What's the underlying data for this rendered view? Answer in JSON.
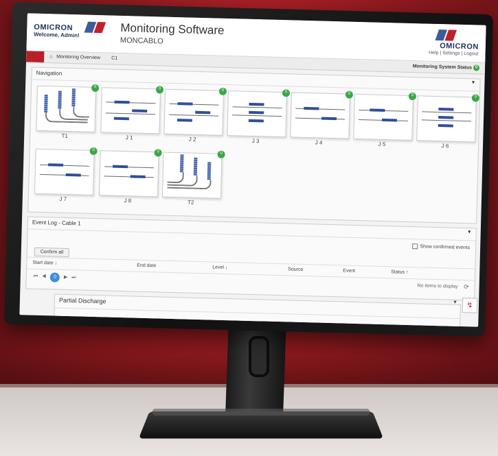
{
  "app": {
    "brand": "OMICRON",
    "welcome": "Welcome, Admin!",
    "title": "Monitoring Software",
    "subtitle": "MONCABLO",
    "right_links": "Help | Settings | Logout"
  },
  "breadcrumb": {
    "items": [
      "Monitoring Overview",
      "C1"
    ],
    "status_label": "Monitoring System Status",
    "status_value": "0"
  },
  "navigation": {
    "title": "Navigation",
    "tiles": [
      {
        "label": "T1",
        "badge": "0"
      },
      {
        "label": "J 1",
        "badge": "0"
      },
      {
        "label": "J 2",
        "badge": "0"
      },
      {
        "label": "J 3",
        "badge": "0"
      },
      {
        "label": "J 4",
        "badge": "0"
      },
      {
        "label": "J 5",
        "badge": "0"
      },
      {
        "label": "J 6",
        "badge": "0"
      },
      {
        "label": "J 7",
        "badge": "0"
      },
      {
        "label": "J 8",
        "badge": "0"
      },
      {
        "label": "T2",
        "badge": "0"
      }
    ]
  },
  "event_log": {
    "title": "Event Log - Cable 1",
    "show_confirmed": "Show confirmed events",
    "confirm_all": "Confirm all",
    "columns": [
      "Start date",
      "End date",
      "Level",
      "Source",
      "Event",
      "Status"
    ],
    "empty": "No items to display",
    "page": "0"
  },
  "partial_discharge": {
    "title": "Partial Discharge"
  },
  "colors": {
    "brand_red": "#c0222a",
    "brand_blue": "#3d5c9c",
    "ok_green": "#3aa846"
  }
}
